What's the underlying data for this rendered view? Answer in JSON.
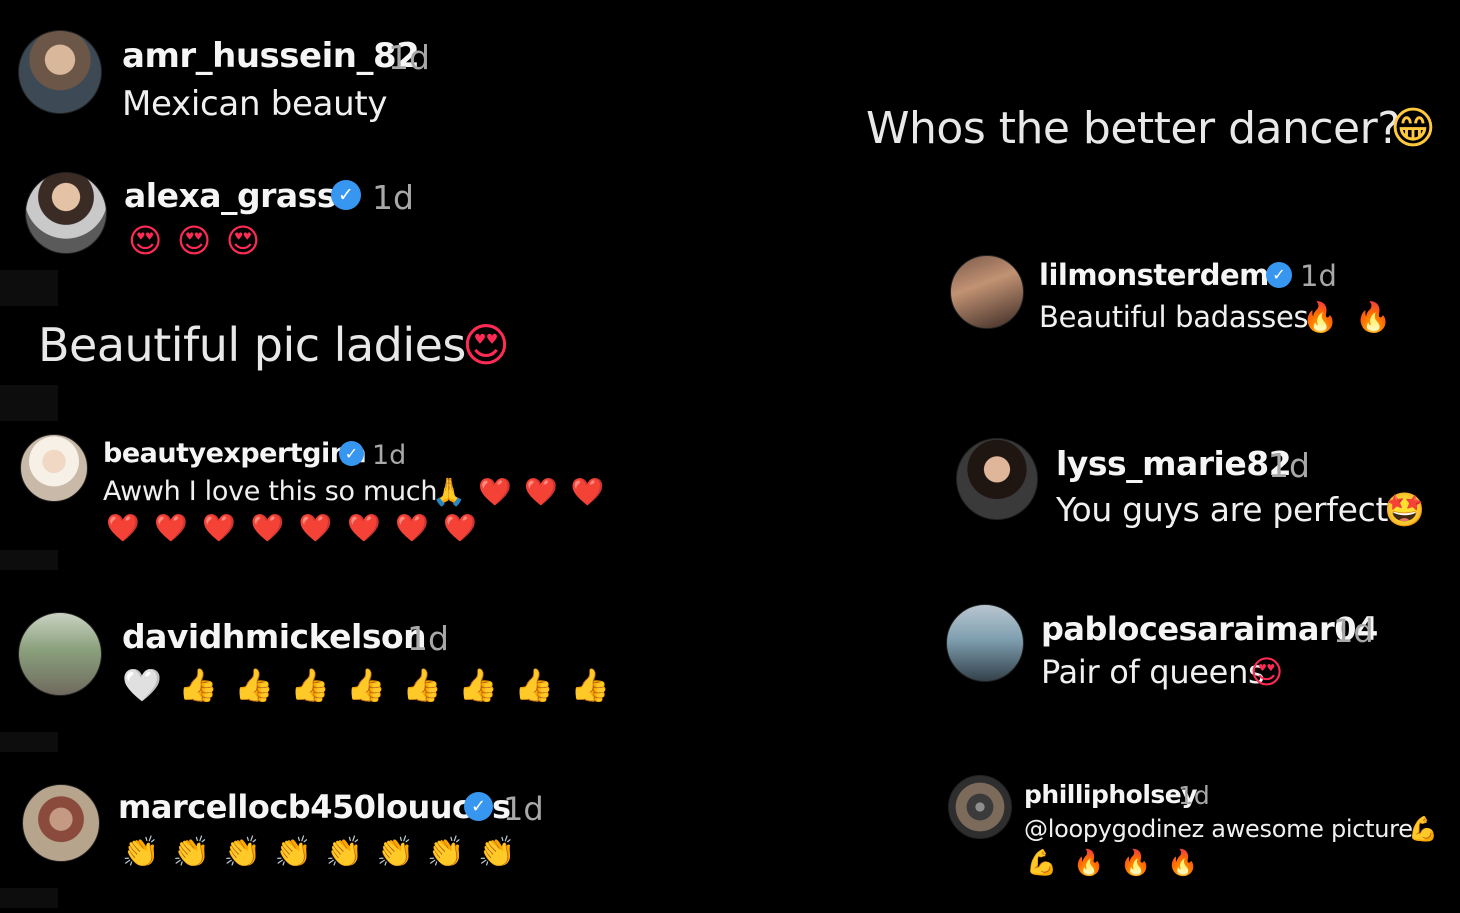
{
  "left_column": {
    "heading": "Beautiful pic ladies",
    "heading_emoji": "😍",
    "comments": [
      {
        "username": "amr_hussein_82",
        "verified": false,
        "time": "1d",
        "text": "Mexican beauty",
        "emojis": ""
      },
      {
        "username": "alexa_grasso",
        "verified": true,
        "time": "1d",
        "text": "",
        "emojis": "😍 😍 😍"
      },
      {
        "username": "beautyexpertgina",
        "verified": true,
        "time": "1d",
        "text": "Awwh I love this so much",
        "emojis": "🙏 ❤️ ❤️ ❤️",
        "emojis_line2": "❤️ ❤️ ❤️ ❤️ ❤️ ❤️ ❤️ ❤️"
      },
      {
        "username": "davidhmickelson",
        "verified": false,
        "time": "1d",
        "text": "",
        "emojis": "🤍 👍 👍 👍 👍 👍 👍 👍 👍"
      },
      {
        "username": "marcellocb450louucos",
        "verified": true,
        "time": "1d",
        "text": "",
        "emojis": "👏 👏 👏 👏 👏 👏 👏 👏"
      }
    ]
  },
  "right_column": {
    "heading": "Whos the better dancer?",
    "heading_emoji": "😁",
    "comments": [
      {
        "username": "lilmonsterdemo",
        "verified": true,
        "time": "1d",
        "text": "Beautiful badasses",
        "emojis": "🔥 🔥"
      },
      {
        "username": "lyss_marie82",
        "verified": false,
        "time": "1d",
        "text": "You guys are perfect",
        "emojis": "🤩"
      },
      {
        "username": "pablocesaraimar04",
        "verified": false,
        "time": "1d",
        "text": "Pair of queens",
        "emojis": "😍"
      },
      {
        "username": "phillipholsey",
        "verified": false,
        "time": "1d",
        "text": "@loopygodinez awesome picture",
        "emojis": "💪",
        "emojis_line2": "💪 🔥 🔥 🔥"
      }
    ]
  },
  "colors": {
    "background": "#000000",
    "verified_badge": "#3797f0",
    "timestamp": "#a8a8a8"
  },
  "icons": {
    "verified": "verified-badge-icon"
  }
}
